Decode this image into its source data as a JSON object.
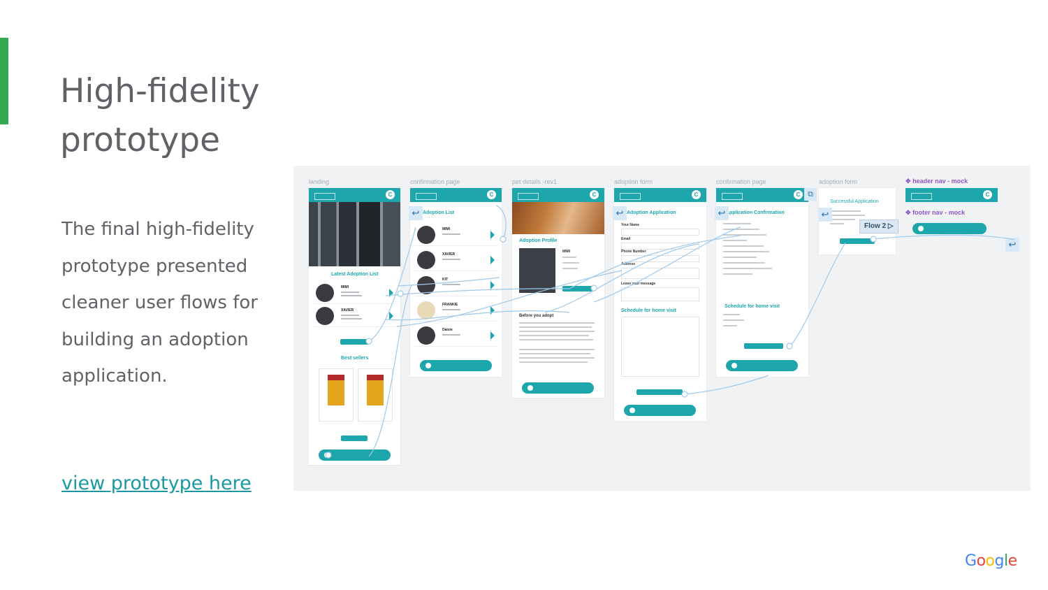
{
  "title_line1": "High-fidelity",
  "title_line2": "prototype",
  "description": "The final high-fidelity prototype presented cleaner user flows for building an adoption application.",
  "link_text": "view prototype here",
  "brand": {
    "letters": [
      "G",
      "o",
      "o",
      "g",
      "l",
      "e"
    ],
    "colors": [
      "#4285f4",
      "#ea4335",
      "#fbbc05",
      "#4285f4",
      "#34a853",
      "#ea4335"
    ]
  },
  "colors": {
    "accent_bar": "#34a853",
    "teal": "#1da6ab",
    "text_gray": "#5f6368",
    "canvas_bg": "#f1f2f4",
    "mock_purple": "#8e58c9",
    "flow_blue": "#9fc9ea"
  },
  "screens": {
    "landing": "landing",
    "confirmation_1": "confirmation page",
    "pet_details": "pet details -rev1",
    "adoption_form_1": "adoption form",
    "confirmation_2": "confirmation page",
    "adoption_form_2": "adoption form"
  },
  "mocks": {
    "header": "header nav - mock",
    "footer": "footer nav - mock",
    "icon": "✥"
  },
  "flow_badge": "Flow 2",
  "landing_screen": {
    "list_title": "Latest Adoption List",
    "best_sellers": "Best sellers",
    "items": [
      {
        "name": "MIMI"
      },
      {
        "name": "XAVIER"
      }
    ]
  },
  "list_screen": {
    "title": "Adoption List",
    "items": [
      {
        "name": "MIMI"
      },
      {
        "name": "XAVIER"
      },
      {
        "name": "KIT"
      },
      {
        "name": "FRANKIE"
      },
      {
        "name": "Daisie"
      }
    ]
  },
  "details_screen": {
    "profile_title": "Adoption Profile",
    "pet_name": "MIMI",
    "before_title": "Before you adopt"
  },
  "form_screen": {
    "title": "Adoption Application",
    "fields": [
      "Your Name",
      "Email",
      "Phone Number",
      "Address",
      "Leave your message"
    ],
    "schedule_title": "Schedule for home visit"
  },
  "confirm_screen": {
    "title": "Application Confirmation",
    "schedule_title": "Schedule for home visit"
  },
  "success_screen": {
    "title": "Successful Application"
  },
  "icons": {
    "back": "back-arrow-icon",
    "avatar": "user-icon",
    "chevron": "chevron-right-icon",
    "play": "play-icon"
  }
}
